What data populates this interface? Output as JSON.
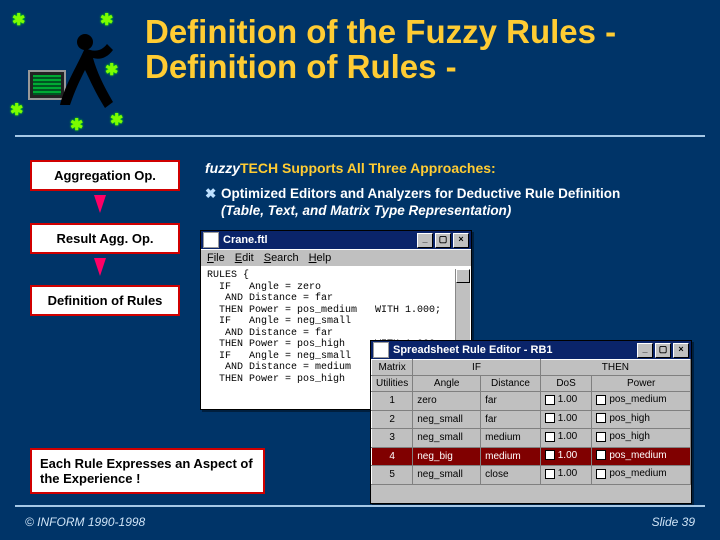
{
  "title": "Definition of the Fuzzy Rules - Definition of Rules -",
  "sidebar": {
    "box1": "Aggregation Op.",
    "box2": "Result Agg. Op.",
    "box3": "Definition of Rules"
  },
  "headline_brand": "fuzzy",
  "headline_brand_suffix": "TECH",
  "headline_rest": " Supports All Three Approaches:",
  "bullet_text": "Optimized Editors and Analyzers for Deductive Rule Definition",
  "bullet_sub": "(Table, Text, and Matrix Type Representation)",
  "footnote": "Each Rule Expresses an Aspect of the Experience !",
  "copyright": "© INFORM 1990-1998",
  "slidenum": "Slide 39",
  "text_window": {
    "title": "Crane.ftl",
    "menu": [
      "File",
      "Edit",
      "Search",
      "Help"
    ],
    "content": "RULES {\n  IF   Angle = zero\n   AND Distance = far\n  THEN Power = pos_medium   WITH 1.000;\n  IF   Angle = neg_small\n   AND Distance = far\n  THEN Power = pos_high     WITH 1.000;\n  IF   Angle = neg_small\n   AND Distance = medium\n  THEN Power = pos_high     WITH 1.000;"
  },
  "grid_window": {
    "title": "Spreadsheet Rule Editor - RB1",
    "tabs": [
      "Matrix",
      "Utilities"
    ],
    "columns": [
      "",
      "IF",
      "",
      "THEN"
    ],
    "subcolumns": [
      "#",
      "Angle",
      "Distance",
      "DoS",
      "Power"
    ],
    "rows": [
      {
        "n": "1",
        "angle": "zero",
        "dist": "far",
        "dos": "1.00",
        "power": "pos_medium",
        "sel": false
      },
      {
        "n": "2",
        "angle": "neg_small",
        "dist": "far",
        "dos": "1.00",
        "power": "pos_high",
        "sel": false
      },
      {
        "n": "3",
        "angle": "neg_small",
        "dist": "medium",
        "dos": "1.00",
        "power": "pos_high",
        "sel": false
      },
      {
        "n": "4",
        "angle": "neg_big",
        "dist": "medium",
        "dos": "1.00",
        "power": "pos_medium",
        "sel": true
      },
      {
        "n": "5",
        "angle": "neg_small",
        "dist": "close",
        "dos": "1.00",
        "power": "pos_medium",
        "sel": false
      }
    ]
  }
}
